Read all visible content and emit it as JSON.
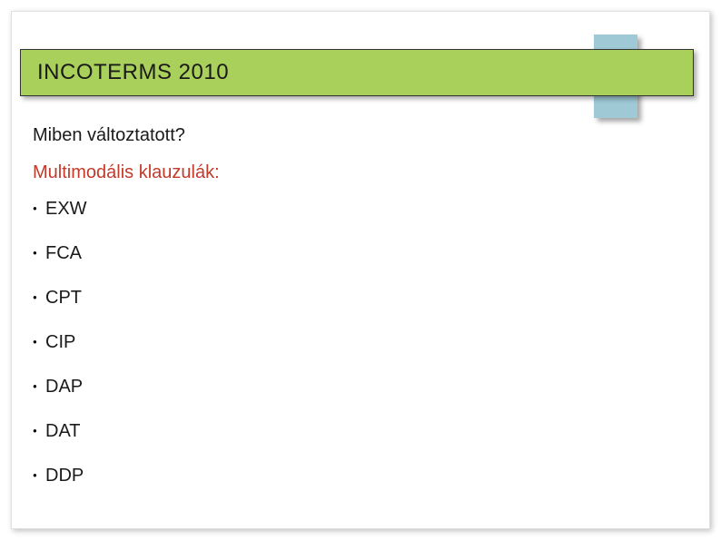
{
  "title": "INCOTERMS 2010",
  "question": "Miben változtatott?",
  "subtitle": "Multimodális klauzulák:",
  "bullets": [
    "EXW",
    "FCA",
    "CPT",
    "CIP",
    "DAP",
    "DAT",
    "DDP"
  ]
}
